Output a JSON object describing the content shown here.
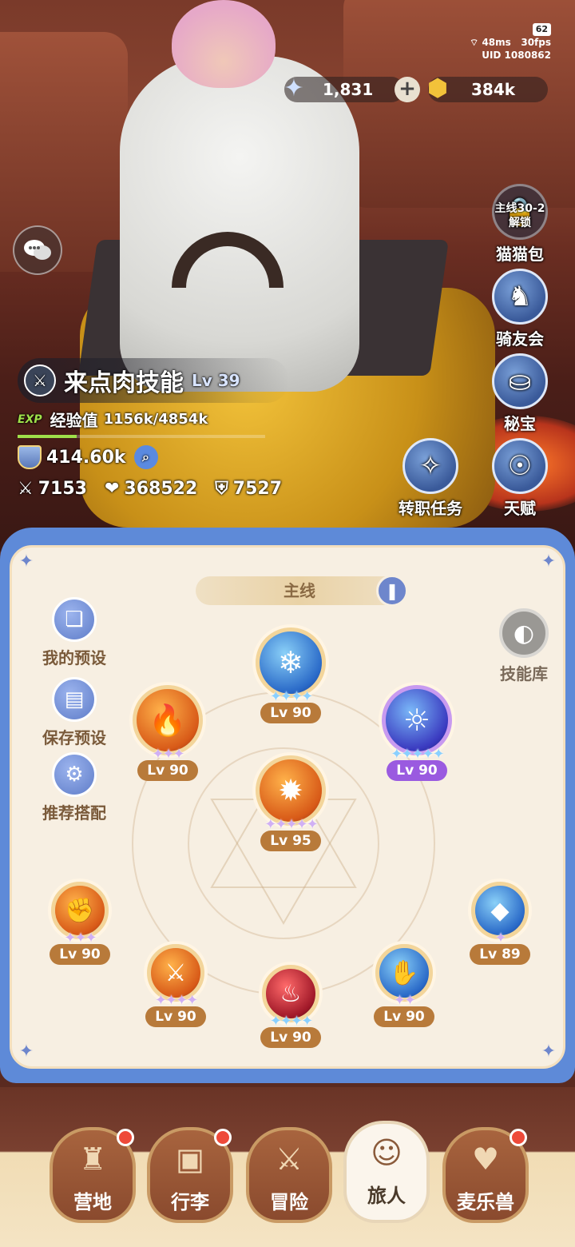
{
  "status": {
    "battery": "62",
    "ping": "48ms",
    "fps": "30fps",
    "uid": "UID 1080862"
  },
  "currency": {
    "gems": "1,831",
    "gold": "384k",
    "gem_icon": "crystal-icon",
    "gold_icon": "coin-icon"
  },
  "side_menu": [
    {
      "label": "猫猫包",
      "lock_text": "主线30-2\n解锁",
      "icon": "lock-icon"
    },
    {
      "label": "骑友会",
      "icon": "horse-icon"
    },
    {
      "label": "秘宝",
      "icon": "treasure-icon"
    },
    {
      "label": "天赋",
      "icon": "brain-icon"
    }
  ],
  "job_quest": {
    "label": "转职任务",
    "icon": "job-icon"
  },
  "player": {
    "name": "来点肉技能",
    "level": "Lv 39",
    "exp_tag": "EXP",
    "exp_label": "经验值",
    "exp_value": "1156k/4854k",
    "exp_fraction": 0.238,
    "power": "414.60k",
    "attack": "7153",
    "hp": "368522",
    "defense": "7527"
  },
  "panel": {
    "tab": "主线",
    "tools": [
      {
        "label": "我的预设",
        "icon": "card-icon"
      },
      {
        "label": "保存预设",
        "icon": "save-icon"
      },
      {
        "label": "推荐搭配",
        "icon": "combo-icon"
      }
    ],
    "library": "技能库"
  },
  "skills": [
    {
      "level": "Lv 90",
      "stars": "4",
      "star_color": "blue",
      "icon": "ice-wall-icon",
      "style": "blue"
    },
    {
      "level": "Lv 90",
      "stars": "3",
      "star_color": "purple",
      "icon": "flame-slash-icon",
      "style": "orange"
    },
    {
      "level": "Lv 90",
      "stars": "5",
      "star_color": "blue",
      "icon": "fire-spirit-icon",
      "style": "purple"
    },
    {
      "level": "Lv 95",
      "stars": "5",
      "star_color": "purple",
      "icon": "meteor-icon",
      "style": "orange"
    },
    {
      "level": "Lv 90",
      "stars": "3",
      "star_color": "purple",
      "icon": "punch-icon",
      "style": "orange"
    },
    {
      "level": "Lv 89",
      "stars": "1",
      "star_color": "purple",
      "icon": "crystal-spire-icon",
      "style": "blue"
    },
    {
      "level": "Lv 90",
      "stars": "4",
      "star_color": "purple",
      "icon": "sword-shield-icon",
      "style": "orange"
    },
    {
      "level": "Lv 90",
      "stars": "4",
      "star_color": "blue",
      "icon": "dark-flame-icon",
      "style": "red"
    },
    {
      "level": "Lv 90",
      "stars": "2",
      "star_color": "purple",
      "icon": "hand-blast-icon",
      "style": "blue"
    }
  ],
  "nav": [
    {
      "label": "营地",
      "icon": "castle-icon",
      "dot": true
    },
    {
      "label": "行李",
      "icon": "backpack-icon",
      "dot": true
    },
    {
      "label": "冒险",
      "icon": "crossed-swords-icon",
      "dot": false
    },
    {
      "label": "旅人",
      "icon": "traveler-icon",
      "dot": false,
      "active": true
    },
    {
      "label": "麦乐兽",
      "icon": "cat-icon",
      "dot": true
    }
  ]
}
